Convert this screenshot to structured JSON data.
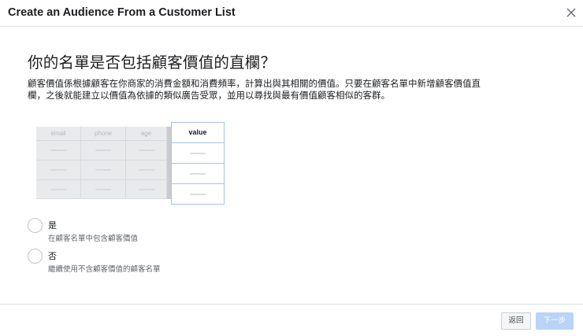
{
  "dialog": {
    "title": "Create an Audience From a Customer List",
    "close_icon": "close-icon"
  },
  "main": {
    "heading": "你的名單是否包括顧客價值的直欄？",
    "description": "顧客價值係根據顧客在你商家的消費金額和消費頻率，計算出與其相關的價值。只要在顧客名單中新增顧客價值直欄，之後就能建立以價值為依據的類似廣告受眾，並用以尋找與最有價值顧客相似的客群。"
  },
  "illustration": {
    "columns": [
      "email",
      "phone",
      "age"
    ],
    "value_column": "value",
    "highlight_color": "#a6c3ee"
  },
  "options": [
    {
      "label": "是",
      "sublabel": "在顧客名單中包含顧客價值",
      "selected": false
    },
    {
      "label": "否",
      "sublabel": "繼續使用不含顧客價值的顧客名單",
      "selected": false
    }
  ],
  "footer": {
    "back_label": "返回",
    "next_label": "下一步",
    "next_disabled": true
  },
  "colors": {
    "primary_disabled": "#b9d4f7",
    "border": "#dddfe2"
  }
}
